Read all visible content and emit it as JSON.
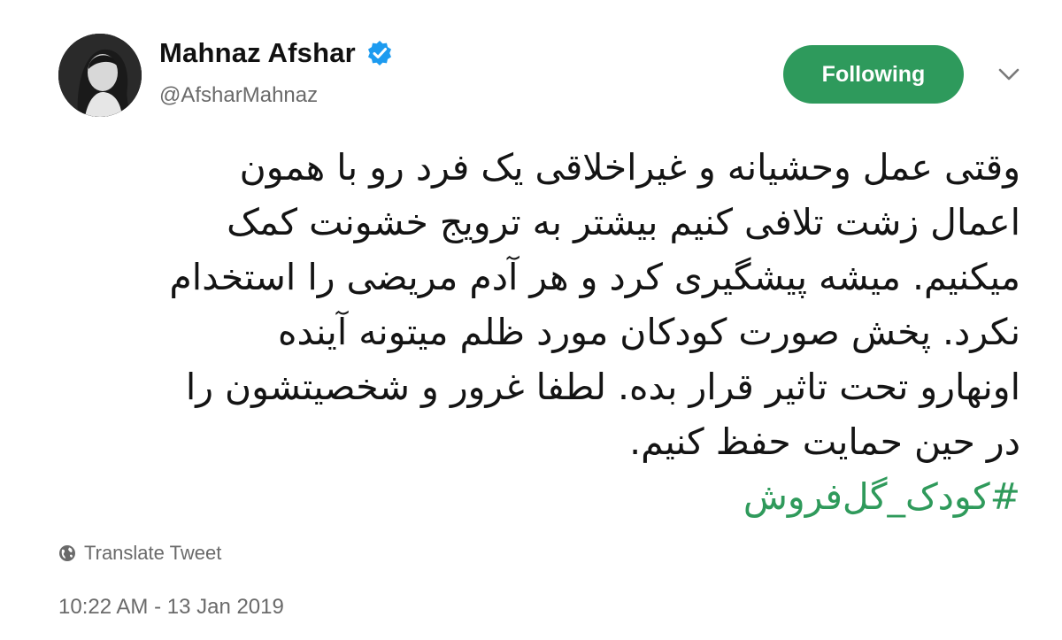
{
  "author": {
    "display_name": "Mahnaz Afshar",
    "handle": "@AfsharMahnaz",
    "verified": true
  },
  "follow_button": {
    "label": "Following",
    "color": "#2e9a5c"
  },
  "tweet": {
    "lines": [
      "وقتی عمل وحشیانه و غیراخلاقی یک فرد رو  با همون",
      "اعمال زشت تلافی کنیم بیشتر به ترویج خشونت کمک",
      "میکنیم. میشه پیشگیری کرد و هر آدم مریضی را استخدام",
      "نکرد. پخش صورت کودکان مورد ظلم میتونه آینده",
      "اونهارو تحت تاثیر قرار بده. لطفا غرور و شخصیتشون را",
      "در حین حمایت حفظ کنیم."
    ],
    "hashtag": "#کودک_گل‌فروش",
    "hashtag_color": "#2f9a5b"
  },
  "translate_label": "Translate Tweet",
  "timestamp": "10:22 AM - 13 Jan 2019",
  "icons": {
    "verified": "verified-badge-icon",
    "caret": "chevron-down-icon",
    "globe": "globe-icon"
  }
}
